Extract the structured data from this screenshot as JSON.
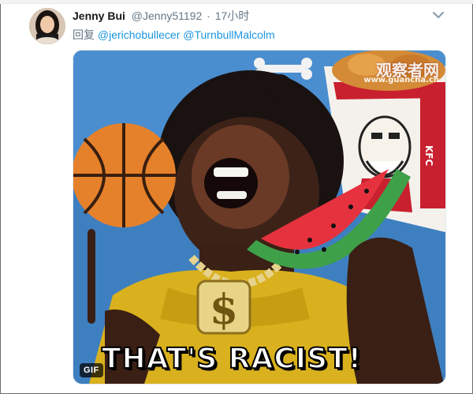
{
  "tweet": {
    "author": {
      "name": "Jenny Bui",
      "handle": "@Jenny51192",
      "separator": "·",
      "time": "17小时"
    },
    "reply": {
      "prefix": "回复",
      "mentions": [
        "@jerichobullecer",
        "@TurnbullMalcolm"
      ]
    },
    "media": {
      "badge": "GIF",
      "watermark": {
        "site": "观察者网",
        "url": "www.guancha.cn"
      },
      "caption": "THAT'S RACIST!",
      "bucket_text": "KFC"
    }
  },
  "colors": {
    "link": "#1b95e0",
    "meta": "#657786",
    "name": "#14171a",
    "sky": "#3e7fc0",
    "shirt": "#d9b11e",
    "melon_red": "#e6323e",
    "melon_green": "#3fa04a"
  },
  "icons": [
    "chevron-down-icon"
  ]
}
